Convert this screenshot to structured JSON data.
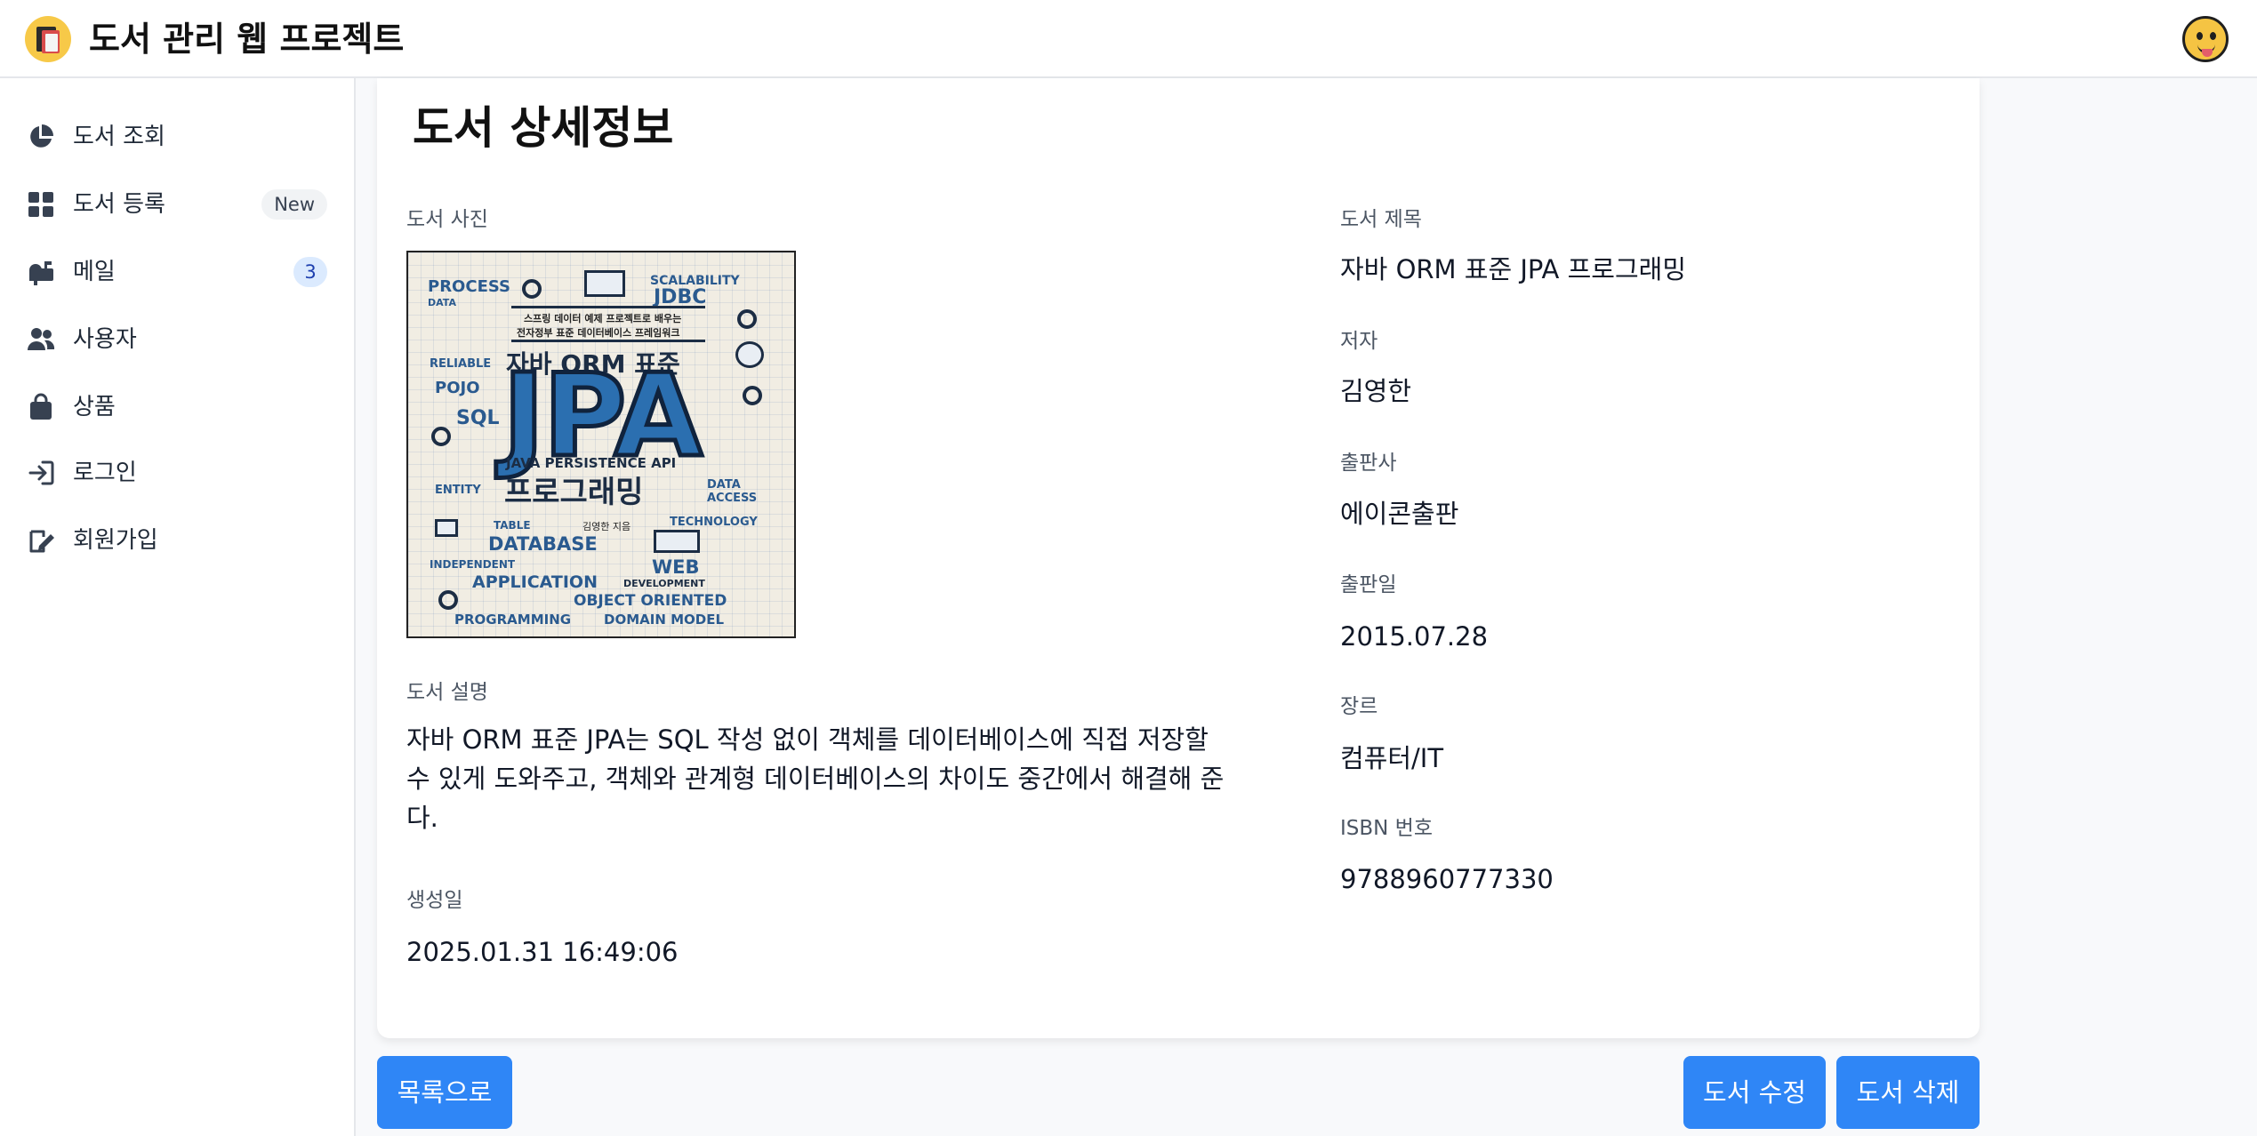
{
  "app": {
    "title": "도서 관리 웹 프로젝트",
    "logo_icon": "books-logo-icon",
    "avatar_icon": "user-avatar-icon"
  },
  "sidebar": {
    "items": [
      {
        "label": "도서 조회",
        "icon": "pie-chart-icon"
      },
      {
        "label": "도서 등록",
        "icon": "grid-icon",
        "badge": "New"
      },
      {
        "label": "메일",
        "icon": "mailbox-icon",
        "badge": "3"
      },
      {
        "label": "사용자",
        "icon": "users-icon"
      },
      {
        "label": "상품",
        "icon": "shopping-bag-icon"
      },
      {
        "label": "로그인",
        "icon": "sign-in-icon"
      },
      {
        "label": "회원가입",
        "icon": "sign-up-icon"
      }
    ]
  },
  "detail": {
    "page_title": "도서 상세정보",
    "photo_label": "도서 사진",
    "description_label": "도서 설명",
    "description": "자바 ORM 표준 JPA는 SQL 작성 없이 객체를 데이터베이스에 직접 저장할 수 있게 도와주고, 객체와 관계형 데이터베이스의 차이도 중간에서 해결해 준다.",
    "created_label": "생성일",
    "created_value": "2025.01.31 16:49:06",
    "fields": [
      {
        "label": "도서 제목",
        "value": "자바 ORM 표준 JPA 프로그래밍"
      },
      {
        "label": "저자",
        "value": "김영한"
      },
      {
        "label": "출판사",
        "value": "에이콘출판"
      },
      {
        "label": "출판일",
        "value": "2015.07.28"
      },
      {
        "label": "장르",
        "value": "컴퓨터/IT"
      },
      {
        "label": "ISBN 번호",
        "value": "9788960777330"
      }
    ]
  },
  "cover": {
    "subtitle_line1": "스프링 데이터 예제 프로젝트로 배우는",
    "subtitle_line2": "전자정부 표준 데이터베이스 프레임워크",
    "heading": "자바 ORM 표준",
    "big_title": "JPA",
    "api_line": "JAVA PERSISTENCE API",
    "program_line": "프로그래밍",
    "author": "김영한 지음",
    "words": [
      "PROCESS",
      "DATA",
      "SCALABILITY",
      "JDBC",
      "RELIABLE",
      "POJO",
      "SQL",
      "ENTITY",
      "DATA ACCESS",
      "TABLE",
      "TECHNOLOGY",
      "DATABASE",
      "INDEPENDENT",
      "WEB",
      "APPLICATION",
      "DEVELOPMENT",
      "OBJECT ORIENTED",
      "PROGRAMMING",
      "DOMAIN MODEL"
    ]
  },
  "buttons": {
    "back": "목록으로",
    "edit": "도서 수정",
    "delete": "도서 삭제"
  },
  "colors": {
    "primary": "#2f86f6",
    "badge_blue_bg": "#dbeafe",
    "badge_gray_bg": "#f1f3f5"
  }
}
